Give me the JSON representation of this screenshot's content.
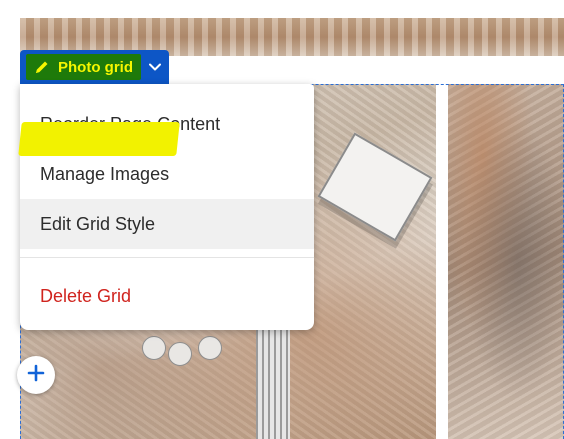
{
  "block_toolbar": {
    "label": "Photo grid",
    "icons": {
      "edit": "pencil-icon",
      "expand": "chevron-down-icon"
    }
  },
  "menu": {
    "items": [
      {
        "label": "Reorder Page Content",
        "style": "default"
      },
      {
        "label": "Manage Images",
        "style": "default"
      },
      {
        "label": "Edit Grid Style",
        "style": "highlighted"
      },
      {
        "label": "Delete Grid",
        "style": "destructive"
      }
    ]
  },
  "add_block": {
    "icon": "plus-icon"
  },
  "colors": {
    "toolbar_blue": "#0d56c6",
    "highlight_yellow": "#f2f200",
    "destructive_red": "#d0241e",
    "plus_blue": "#1163d8"
  }
}
